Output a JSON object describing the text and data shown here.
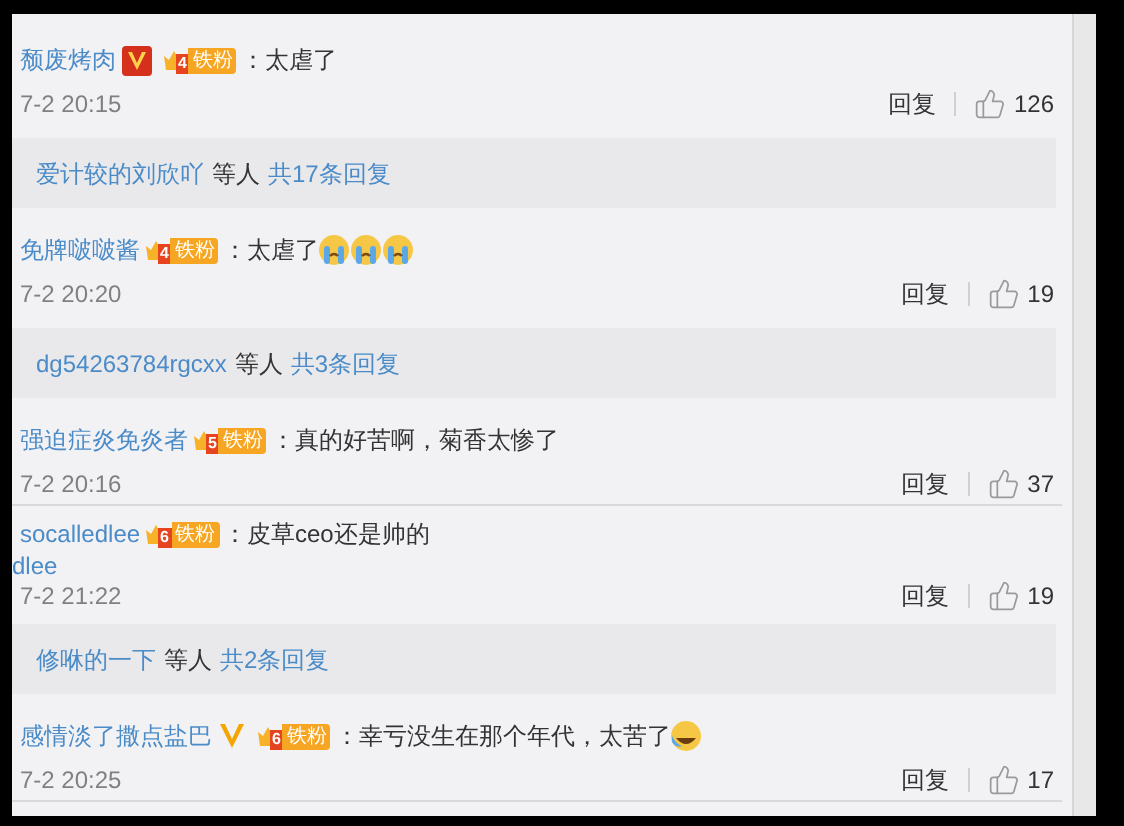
{
  "comments": [
    {
      "user": "颓废烤肉",
      "vip": {
        "kind": "red"
      },
      "fan_level": "4",
      "fan_label": "铁粉",
      "colon": "：",
      "text": "太虐了",
      "time": "7-2 20:15",
      "reply": "回复",
      "likes": "126",
      "replies": {
        "user": "爱计较的刘欣吖",
        "etc": "等人",
        "count": "共17条回复"
      }
    },
    {
      "user": "免牌啵啵酱",
      "fan_level": "4",
      "fan_label": "铁粉",
      "colon": "：",
      "text": "太虐了",
      "emojis": [
        {
          "kind": "crying"
        },
        {
          "kind": "crying"
        },
        {
          "kind": "crying"
        }
      ],
      "time": "7-2 20:20",
      "reply": "回复",
      "likes": "19",
      "replies": {
        "user": "dg54263784rgcxx",
        "etc": "等人",
        "count": "共3条回复"
      }
    },
    {
      "user": "强迫症炎免炎者",
      "fan_level": "5",
      "fan_label": "铁粉",
      "colon": "：",
      "text": "真的好苦啊，菊香太惨了",
      "time": "7-2 20:16",
      "reply": "回复",
      "likes": "37"
    },
    {
      "user": "socalledlee",
      "fan_level": "6",
      "fan_label": "铁粉",
      "colon": "：",
      "text": "皮草ceo还是帅的",
      "overflow": "dlee",
      "time": "7-2 21:22",
      "reply": "回复",
      "likes": "19",
      "replies": {
        "user": "修咻的一下",
        "etc": "等人",
        "count": "共2条回复"
      }
    },
    {
      "user": "感情淡了撒点盐巴",
      "vip": {
        "kind": "yellow"
      },
      "fan_level": "6",
      "fan_label": "铁粉",
      "colon": "：",
      "text": "幸亏没生在那个年代，太苦了",
      "emojis": [
        {
          "kind": "laughing"
        }
      ],
      "time": "7-2 20:25",
      "reply": "回复",
      "likes": "17"
    }
  ]
}
